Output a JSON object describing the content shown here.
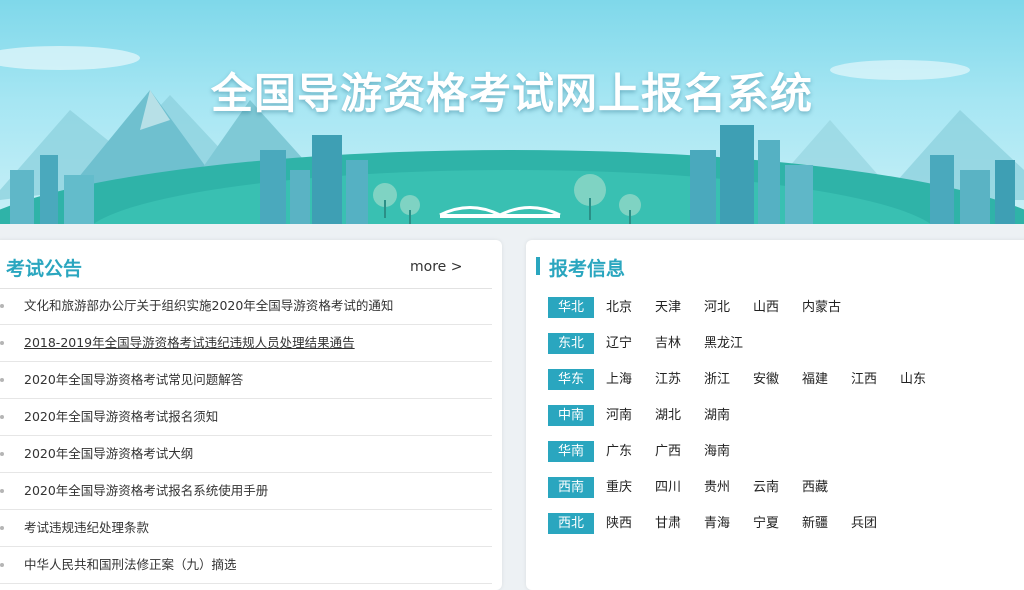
{
  "header": {
    "title": "全国导游资格考试网上报名系统"
  },
  "notices": {
    "title": "考试公告",
    "more_label": "more >",
    "items": [
      "文化和旅游部办公厅关于组织实施2020年全国导游资格考试的通知",
      "2018-2019年全国导游资格考试违纪违规人员处理结果通告",
      "2020年全国导游资格考试常见问题解答",
      "2020年全国导游资格考试报名须知",
      "2020年全国导游资格考试大纲",
      "2020年全国导游资格考试报名系统使用手册",
      "考试违规违纪处理条款",
      "中华人民共和国刑法修正案（九）摘选"
    ]
  },
  "info": {
    "title": "报考信息",
    "regions": [
      {
        "name": "华北",
        "provinces": [
          "北京",
          "天津",
          "河北",
          "山西",
          "内蒙古"
        ]
      },
      {
        "name": "东北",
        "provinces": [
          "辽宁",
          "吉林",
          "黑龙江"
        ]
      },
      {
        "name": "华东",
        "provinces": [
          "上海",
          "江苏",
          "浙江",
          "安徽",
          "福建",
          "江西",
          "山东"
        ]
      },
      {
        "name": "中南",
        "provinces": [
          "河南",
          "湖北",
          "湖南"
        ]
      },
      {
        "name": "华南",
        "provinces": [
          "广东",
          "广西",
          "海南"
        ]
      },
      {
        "name": "西南",
        "provinces": [
          "重庆",
          "四川",
          "贵州",
          "云南",
          "西藏"
        ]
      },
      {
        "name": "西北",
        "provinces": [
          "陕西",
          "甘肃",
          "青海",
          "宁夏",
          "新疆",
          "兵团"
        ]
      }
    ]
  },
  "colors": {
    "accent": "#2aa6bf",
    "page_bg": "#edf1f4"
  }
}
